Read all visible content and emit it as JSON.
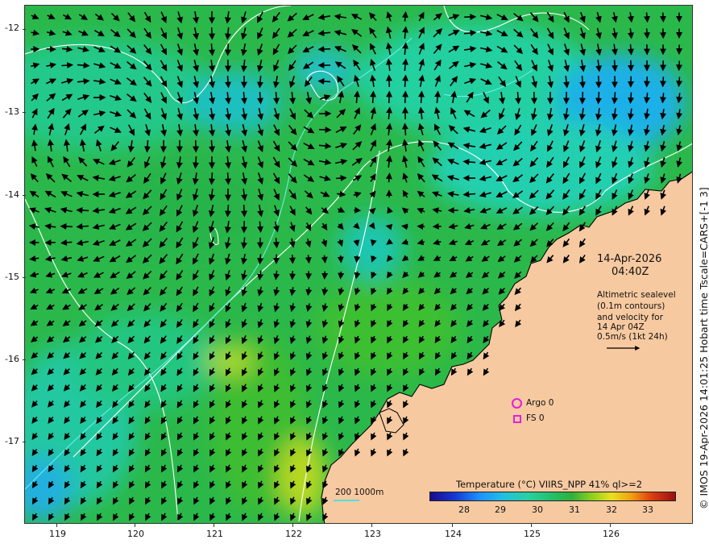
{
  "map": {
    "date_line1": "14-Apr-2026",
    "date_line2": "04:40Z",
    "annotation_lines": [
      "Altimetric sealevel",
      "(0.1m contours)",
      "and velocity for",
      "14 Apr 04Z",
      "0.5m/s (1kt 24h)"
    ],
    "side_caption": "© IMOS 19-Apr-2026 14:01:25 Hobart time Tscale=CARS+[-1 3]",
    "legend": {
      "argo": "Argo 0",
      "fs": "FS 0"
    },
    "scale": {
      "label": "200  1000m"
    },
    "colorbar": {
      "title": "Temperature (°C) VIIRS_NPP 41% ql>=2",
      "ticks": [
        "28",
        "29",
        "30",
        "31",
        "32",
        "33"
      ]
    },
    "y_ticks": [
      "-12",
      "-13",
      "-14",
      "-15",
      "-16",
      "-17"
    ],
    "x_ticks": [
      "119",
      "120",
      "121",
      "122",
      "123",
      "124",
      "125",
      "126"
    ],
    "colors": {
      "land": "#f7c9a0",
      "coast": "#000000",
      "sea_green": "#2bb84a",
      "sea_teal": "#20d8a8",
      "sea_blue": "#1ea0f0",
      "contour": "#ffffff",
      "isobath": "#70f0f0",
      "marker": "#e020e0",
      "arrow": "#000000"
    },
    "icons": [
      "argo-circle-icon",
      "fs-square-icon",
      "velocity-scale-arrow-icon"
    ]
  }
}
